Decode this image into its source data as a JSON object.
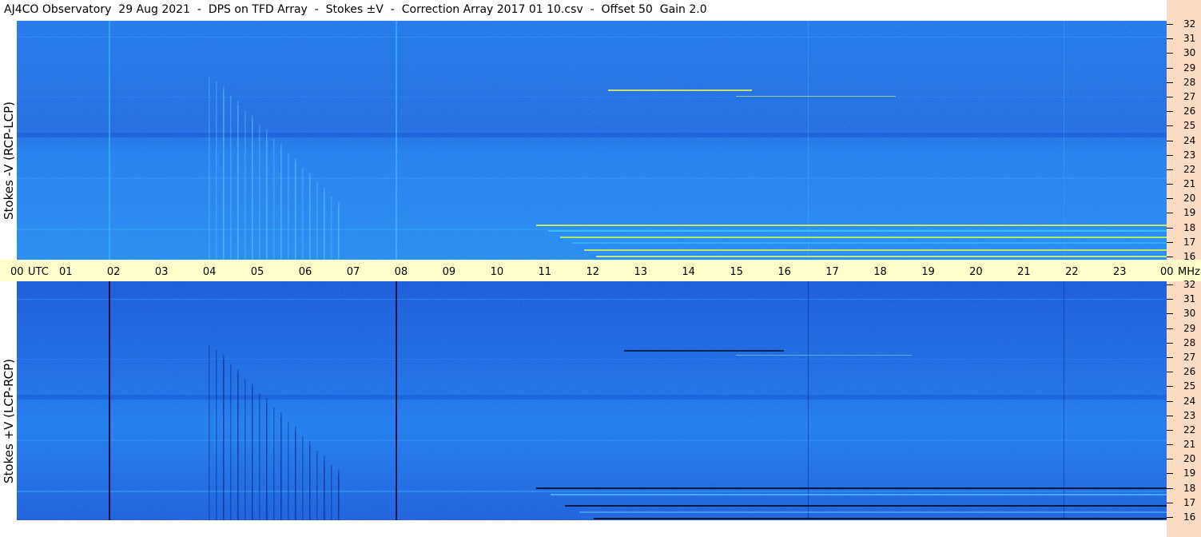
{
  "title": "AJ4CO Observatory  29 Aug 2021  -  DPS on TFD Array  -  Stokes ±V  -  Correction Array 2017 01 10.csv  -  Offset 50  Gain 2.0",
  "colors": {
    "background_top": "#1a6ee8",
    "background_bottom": "#1558d8",
    "axis_band": "#ffffcc",
    "right_strip": "#fbdcc3"
  },
  "chart_data": [
    {
      "type": "heatmap",
      "ylabel": "Stokes -V (RCP-LCP)",
      "xlabel": "UTC",
      "x_ticks": [
        "00",
        "01",
        "02",
        "03",
        "04",
        "05",
        "06",
        "07",
        "08",
        "09",
        "10",
        "11",
        "12",
        "13",
        "14",
        "15",
        "16",
        "17",
        "18",
        "19",
        "20",
        "21",
        "22",
        "23",
        "00"
      ],
      "y_unit": "MHz",
      "y_ticks": [
        32,
        31,
        30,
        29,
        28,
        27,
        26,
        25,
        24,
        23,
        22,
        21,
        20,
        19,
        18,
        17,
        16
      ],
      "ylim": [
        16,
        32
      ],
      "xlim": [
        0,
        24
      ]
    },
    {
      "type": "heatmap",
      "ylabel": "Stokes +V (LCP-RCP)",
      "xlabel": "UTC",
      "x_ticks": [
        "00",
        "01",
        "02",
        "03",
        "04",
        "05",
        "06",
        "07",
        "08",
        "09",
        "10",
        "11",
        "12",
        "13",
        "14",
        "15",
        "16",
        "17",
        "18",
        "19",
        "20",
        "21",
        "22",
        "23",
        "00"
      ],
      "y_unit": "MHz",
      "y_ticks": [
        32,
        31,
        30,
        29,
        28,
        27,
        26,
        25,
        24,
        23,
        22,
        21,
        20,
        19,
        18,
        17,
        16
      ],
      "ylim": [
        16,
        32
      ],
      "xlim": [
        0,
        24
      ]
    }
  ]
}
